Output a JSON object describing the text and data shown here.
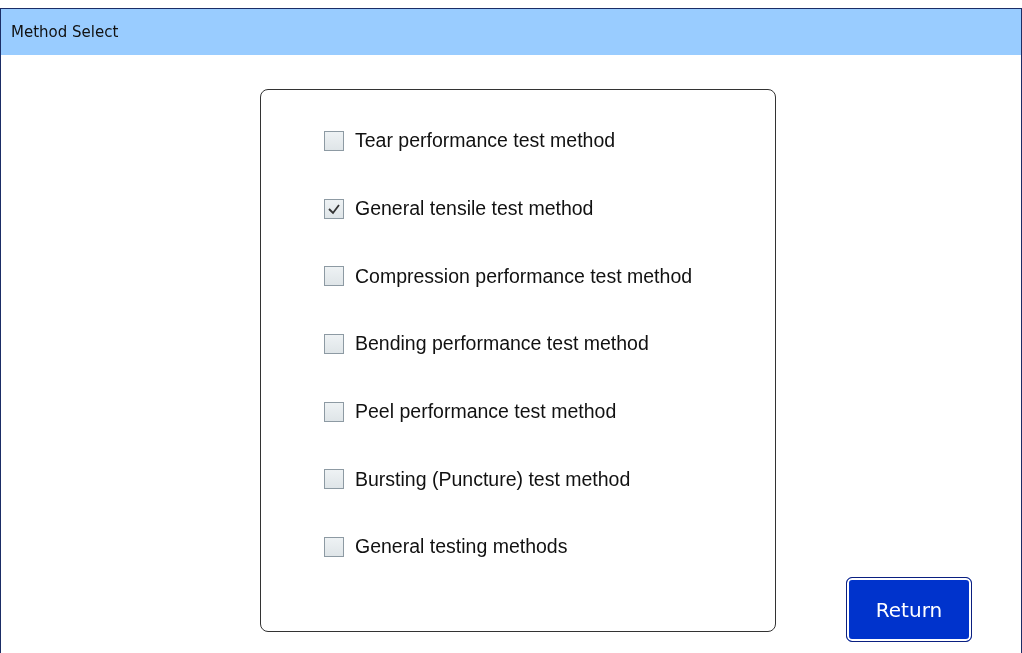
{
  "window": {
    "title": "Method Select"
  },
  "methods": [
    {
      "label": "Tear performance test method",
      "checked": false
    },
    {
      "label": "General tensile test method",
      "checked": true
    },
    {
      "label": "Compression performance test method",
      "checked": false
    },
    {
      "label": "Bending performance test method",
      "checked": false
    },
    {
      "label": "Peel performance test method",
      "checked": false
    },
    {
      "label": "Bursting (Puncture) test method",
      "checked": false
    },
    {
      "label": "General testing methods",
      "checked": false
    }
  ],
  "buttons": [
    "Return"
  ]
}
